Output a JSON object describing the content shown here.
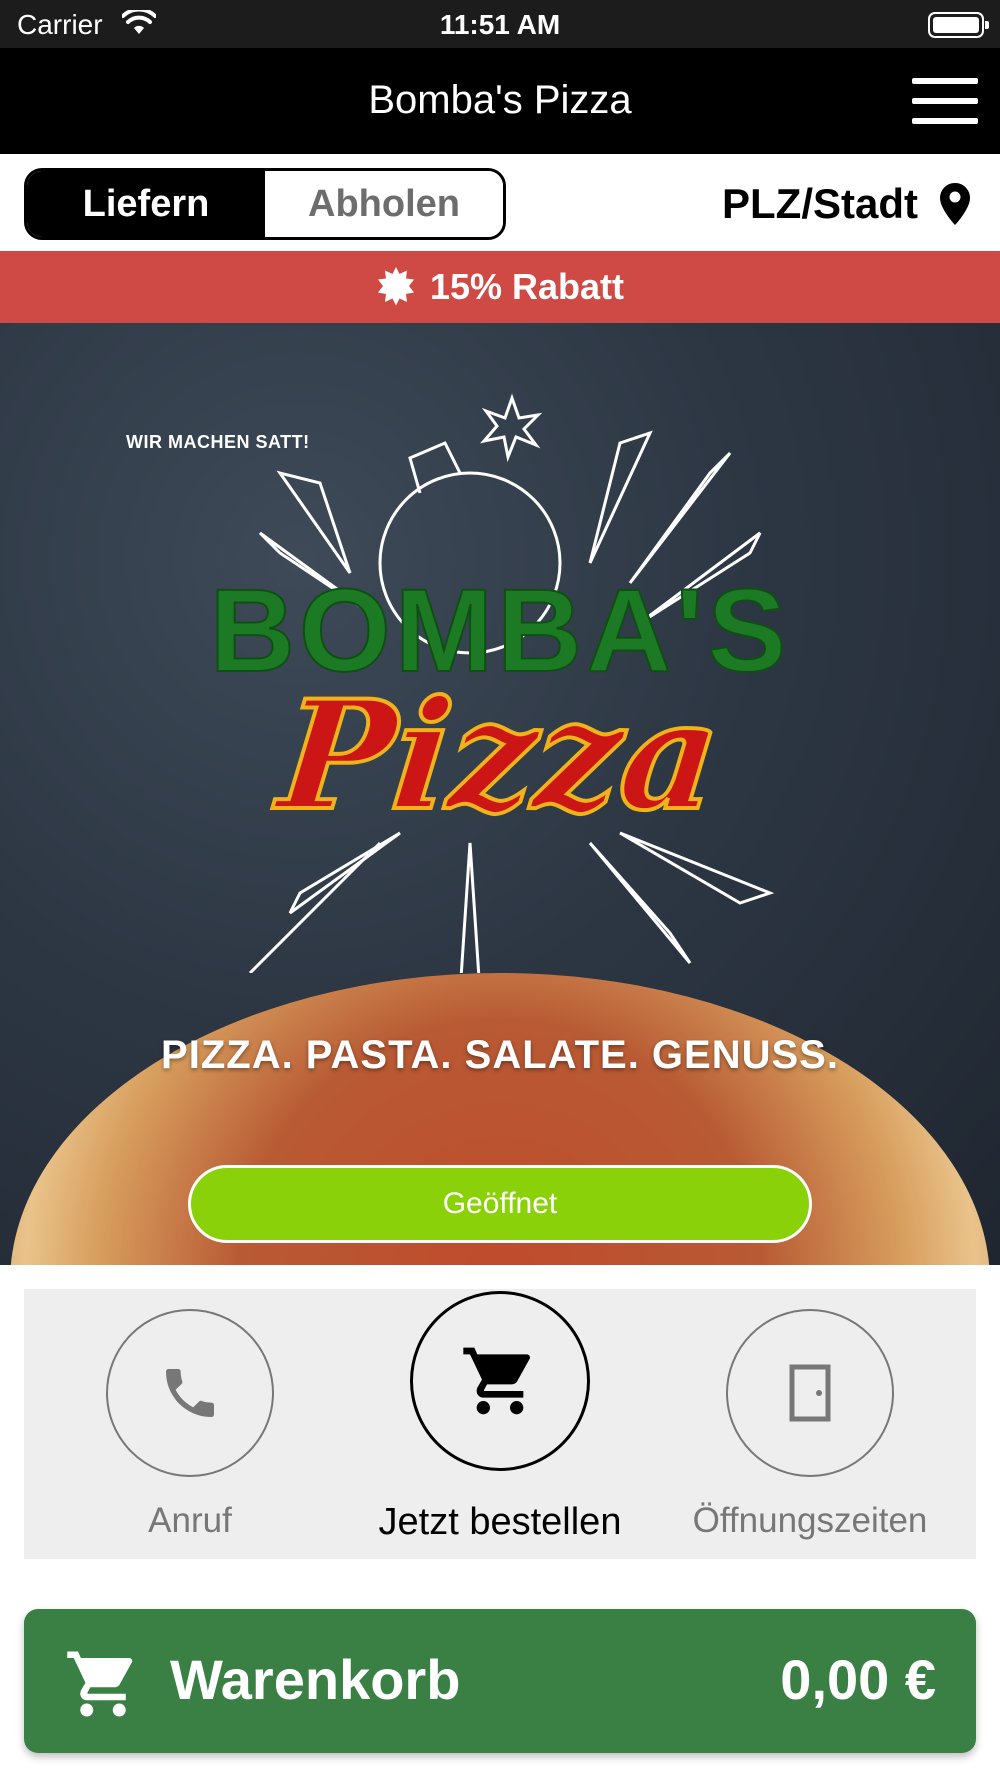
{
  "status_bar": {
    "carrier": "Carrier",
    "time": "11:51 AM",
    "icons": [
      "wifi-icon",
      "battery-icon"
    ]
  },
  "header": {
    "title": "Bomba's Pizza",
    "menu_icon": "hamburger-menu-icon"
  },
  "order_mode": {
    "options": [
      "Liefern",
      "Abholen"
    ],
    "selected": "Liefern"
  },
  "location": {
    "label": "PLZ/Stadt",
    "icon": "map-pin-icon"
  },
  "promo": {
    "text": "15% Rabatt",
    "icon": "starburst-icon"
  },
  "hero": {
    "logo_tagline": "WIR MACHEN SATT!",
    "logo_brand": "BOMBA'S",
    "logo_sub": "Pizza",
    "tagline": "PIZZA. PASTA. SALATE. GENUSS.",
    "status": "Geöffnet"
  },
  "actions": [
    {
      "label": "Anruf",
      "icon": "phone-icon"
    },
    {
      "label": "Jetzt bestellen",
      "icon": "cart-icon"
    },
    {
      "label": "Öffnungszeiten",
      "icon": "door-icon"
    }
  ],
  "cart": {
    "label": "Warenkorb",
    "total": "0,00 €",
    "icon": "cart-icon"
  },
  "colors": {
    "header_bg": "#000000",
    "promo_bg": "#cf4a45",
    "open_badge": "#8bd10a",
    "cart_bg": "#3a7f44",
    "logo_green": "#1c7a24",
    "logo_red": "#cc1515"
  }
}
